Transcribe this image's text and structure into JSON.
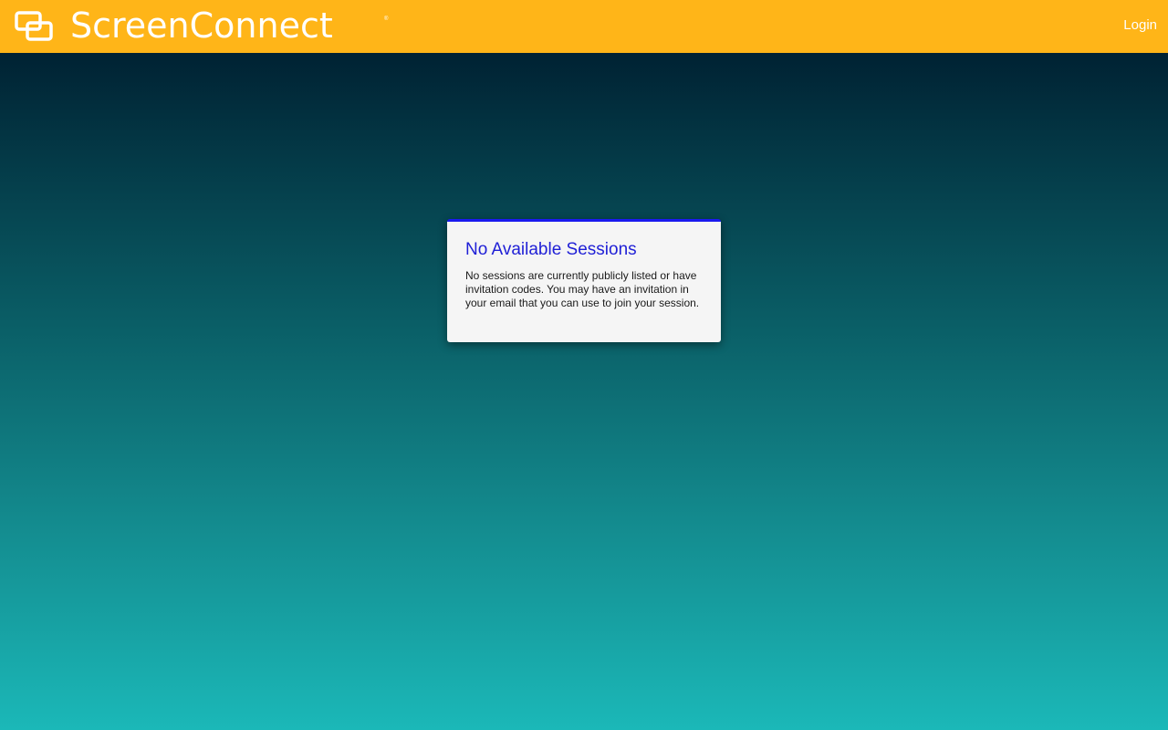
{
  "header": {
    "brand": "ScreenConnect",
    "brand_mark": "®",
    "login_label": "Login",
    "logo_icon": "screenconnect-logo-icon"
  },
  "notice": {
    "title": "No Available Sessions",
    "message": "No sessions are currently publicly listed or have invitation codes. You may have an invitation in your email that you can use to join your session."
  },
  "colors": {
    "header_bg": "#ffb518",
    "title_text": "#1f1fd6",
    "card_accent": "#1a1aee",
    "gradient_top": "#002233",
    "gradient_bottom": "#1bb8b8"
  }
}
